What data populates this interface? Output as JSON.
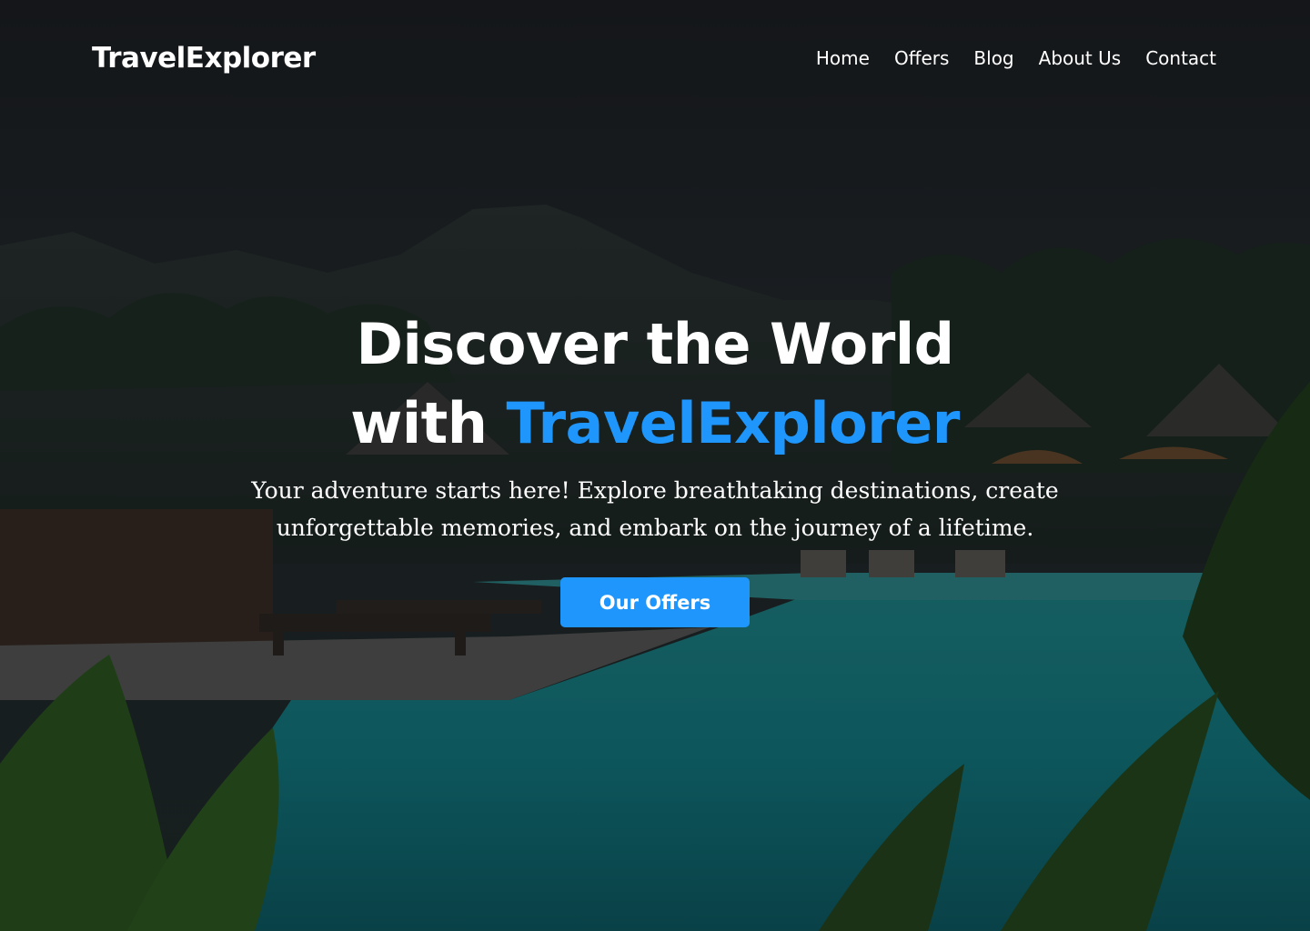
{
  "nav": {
    "logo": "TravelExplorer",
    "links": [
      "Home",
      "Offers",
      "Blog",
      "About Us",
      "Contact"
    ]
  },
  "hero": {
    "headline_line1": "Discover the World",
    "headline_line2_prefix": "with ",
    "headline_line2_accent": "TravelExplorer",
    "subtitle": "Your adventure starts here! Explore breathtaking destinations, create unforgettable memories, and embark on the journey of a lifetime.",
    "cta_label": "Our Offers"
  },
  "colors": {
    "accent": "#1e96fc",
    "text": "#ffffff"
  },
  "icons": {
    "background": "tropical-resort-pool-photo"
  }
}
